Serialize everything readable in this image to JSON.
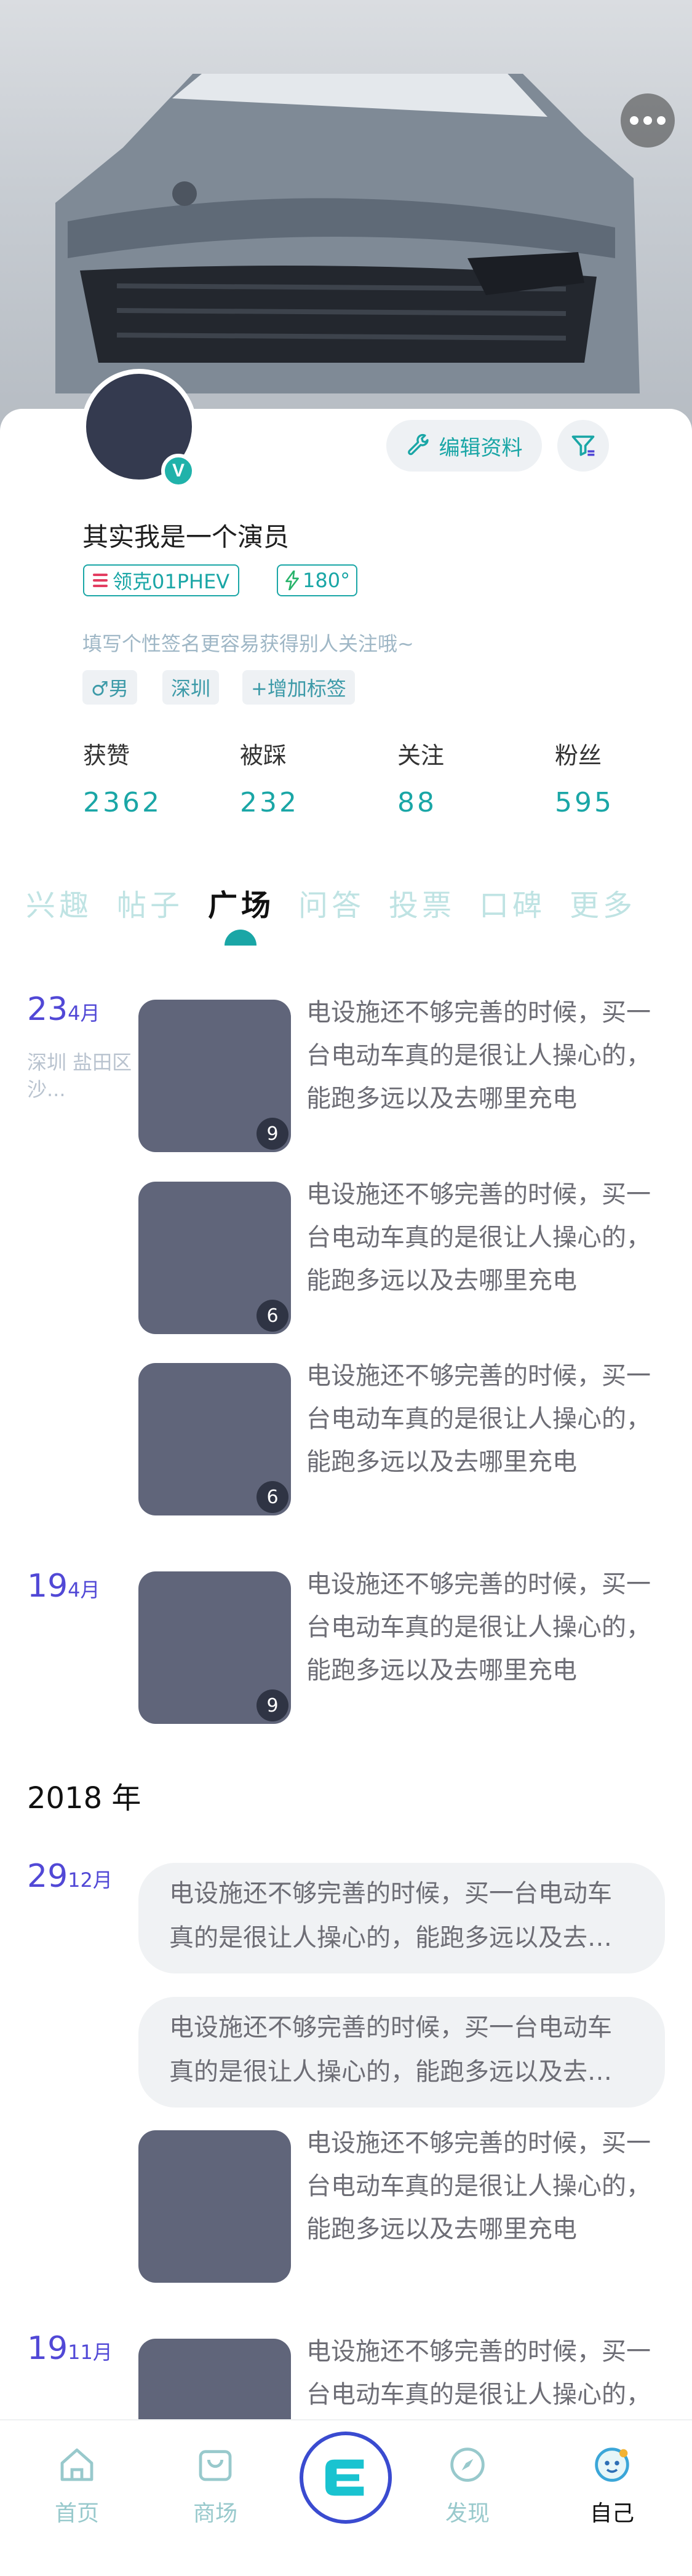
{
  "profile": {
    "more_icon": "ellipsis-icon",
    "verified_label": "V",
    "edit_label": "编辑资料",
    "nickname": "其实我是一个演员",
    "car_tag": "领克01PHEV",
    "level_tag": "180°",
    "signature": "填写个性签名更容易获得别人关注哦~",
    "tags": [
      "♂男",
      "深圳",
      "+增加标签"
    ]
  },
  "stats": [
    {
      "label": "获赞",
      "value": "2362"
    },
    {
      "label": "被踩",
      "value": "232"
    },
    {
      "label": "关注",
      "value": "88"
    },
    {
      "label": "粉丝",
      "value": "595"
    }
  ],
  "tabs": [
    "兴趣",
    "帖子",
    "广场",
    "问答",
    "投票",
    "口碑",
    "更多"
  ],
  "active_tab": "广场",
  "feed": {
    "group1": {
      "day": "23",
      "month": "4月",
      "location": "深圳 盐田区沙..."
    },
    "group2": {
      "day": "19",
      "month": "4月"
    },
    "year": "2018 年",
    "group3": {
      "day": "29",
      "month": "12月"
    },
    "group4": {
      "day": "19",
      "month": "11月"
    },
    "posts": [
      {
        "text": "电设施还不够完善的时候，买一台电动车真的是很让人操心的，能跑多远以及去哪里充电",
        "count": "9"
      },
      {
        "text": "电设施还不够完善的时候，买一台电动车真的是很让人操心的，能跑多远以及去哪里充电",
        "count": "6"
      },
      {
        "text": "电设施还不够完善的时候，买一台电动车真的是很让人操心的，能跑多远以及去哪里充电",
        "count": "6"
      },
      {
        "text": "电设施还不够完善的时候，买一台电动车真的是很让人操心的，能跑多远以及去哪里充电",
        "count": "9"
      },
      {
        "text": "电设施还不够完善的时候，买一台电动车真的是很让人操心的，能跑多远以及去哪里充电"
      },
      {
        "text": "电设施还不够完善的时候，买一台电动车真的是很让人操心的，能跑多远以及去哪里充电"
      },
      {
        "text": "电设施还不够完善的时候，买一台电动车真的是很让人操心的，能跑多远以及去哪里充电"
      },
      {
        "text": "电设施还不够完善的时候，买一台电动车真的是很让人操心的，能跑多远以及去哪里充电"
      }
    ]
  },
  "bottom_nav": [
    {
      "label": "首页",
      "icon": "home-icon"
    },
    {
      "label": "商场",
      "icon": "shopping-bag-icon"
    },
    {
      "label": "",
      "icon": "e-logo-icon"
    },
    {
      "label": "发现",
      "icon": "compass-icon"
    },
    {
      "label": "自己",
      "icon": "profile-face-icon"
    }
  ],
  "colors": {
    "accent": "#1aa6a6",
    "date": "#5148d6",
    "tab_inactive": "#bfe3e3"
  }
}
